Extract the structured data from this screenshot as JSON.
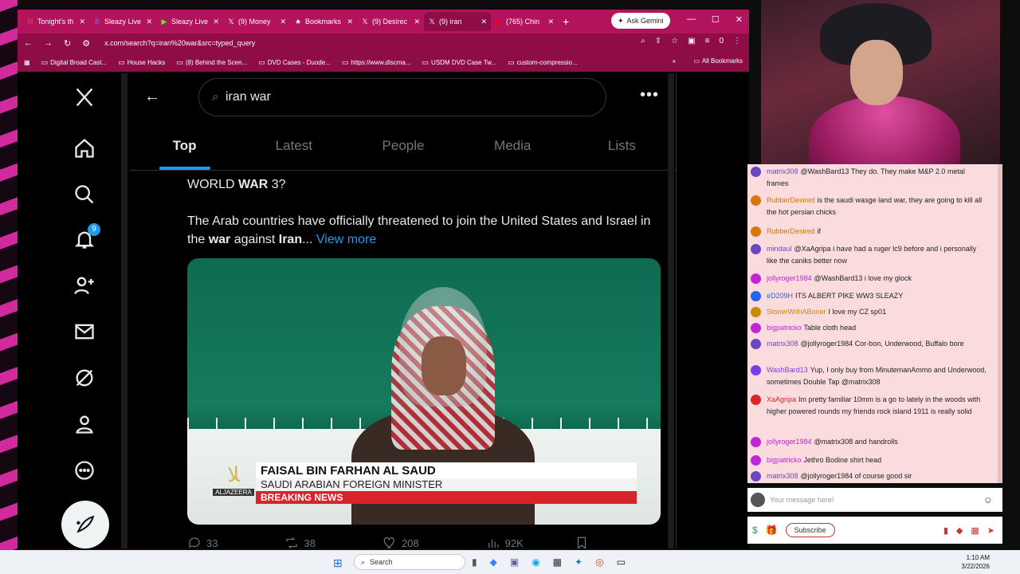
{
  "browser": {
    "tabs": [
      {
        "icon": "gmail-icon",
        "glyph": "M",
        "color": "#ea4335",
        "label": "Tonight's th"
      },
      {
        "icon": "kick-icon",
        "glyph": "B",
        "color": "#4f7cff",
        "label": "Sleazy Live"
      },
      {
        "icon": "kick-icon",
        "glyph": "▶",
        "color": "#53fc18",
        "label": "Sleazy Live"
      },
      {
        "icon": "x-logo-icon",
        "glyph": "𝕏",
        "color": "#ffffff",
        "label": "(9) Money"
      },
      {
        "icon": "bookmark-star-icon",
        "glyph": "★",
        "color": "#ffffff",
        "label": "Bookmarks"
      },
      {
        "icon": "x-logo-icon",
        "glyph": "𝕏",
        "color": "#ffffff",
        "label": "(9) Desirec"
      },
      {
        "icon": "x-logo-icon",
        "glyph": "𝕏",
        "color": "#ffffff",
        "label": "(9) iran"
      },
      {
        "icon": "youtube-icon",
        "glyph": "▶",
        "color": "#ff0000",
        "label": "(765) Chin"
      }
    ],
    "ask_gemini": "Ask Gemini",
    "url": "x.com/search?q=iran%20war&src=typed_query",
    "profile_initial": "0",
    "bookmarks": [
      {
        "icon": "folder-icon",
        "label": "Digital Broad Cast..."
      },
      {
        "icon": "folder-icon",
        "label": "House Hacks"
      },
      {
        "icon": "youtube-icon",
        "label": "(8) Behind the Scen..."
      },
      {
        "icon": "dvd-icon",
        "label": "DVD Cases - Duode..."
      },
      {
        "icon": "globe-icon",
        "label": "https://www.discma..."
      },
      {
        "icon": "globe-icon",
        "label": "USDM DVD Case Tw..."
      },
      {
        "icon": "globe-icon",
        "label": "custom-compressio..."
      }
    ],
    "all_bookmarks": "All Bookmarks"
  },
  "x": {
    "notification_count": "9",
    "search_query": "iran war",
    "tabs": [
      "Top",
      "Latest",
      "People",
      "Media",
      "Lists"
    ],
    "tweet": {
      "line1_pre": "WORLD ",
      "line1_bold": "WAR",
      "line1_post": " 3?",
      "p2_a": "The Arab countries have officially threatened to join the United States and Israel in the ",
      "p2_b": "war",
      "p2_c": " against ",
      "p2_d": "Iran",
      "p2_e": "... ",
      "view_more": "View more",
      "lower_third_name": "FAISAL BIN FARHAN AL SAUD",
      "lower_third_title": "SAUDI ARABIAN FOREIGN MINISTER",
      "lower_third_breaking": "BREAKING NEWS",
      "network": "ALJAZEERA",
      "replies": "33",
      "reposts": "38",
      "likes": "208",
      "views": "92K"
    }
  },
  "chat": {
    "messages": [
      {
        "user": "matrix308",
        "color": "#6b46c1",
        "text": "@WashBard13 They do. They make M&P 2.0 metal frames"
      },
      {
        "user": "RubberDesired",
        "color": "#d97706",
        "text": "is the saudi wasge land war, they are going to kill all the hot persian chicks"
      },
      {
        "user": "RubberDesired",
        "color": "#d97706",
        "text": "if"
      },
      {
        "user": "mindaul",
        "color": "#6b46c1",
        "text": "@XaAgripa i have had a ruger lc9 before and i personally like the caniks better now"
      },
      {
        "user": "jollyroger1984",
        "color": "#c026d3",
        "text": "@WashBard13 i love my glock"
      },
      {
        "user": "eD209H",
        "color": "#2563eb",
        "text": "ITS ALBERT PIKE WW3 SLEAZY"
      },
      {
        "user": "StonerWithABoner",
        "color": "#ca8a04",
        "text": "I love my CZ sp01"
      },
      {
        "user": "bigpatricko",
        "color": "#c026d3",
        "text": "Table cloth head"
      },
      {
        "user": "matrix308",
        "color": "#6b46c1",
        "text": "@jollyroger1984 Cor-bon, Underwood, Buffalo bore"
      },
      {
        "user": "WashBard13",
        "color": "#7c3aed",
        "text": "Yup, I only buy from MinutemanAmmo and Underwood, sometimes Double Tap @matrix308"
      },
      {
        "user": "XaAgripa",
        "color": "#dc2626",
        "text": "Im pretty familiar 10mm is a go to lately in the woods with higher powered rounds my friends rock island 1911 is really solid"
      },
      {
        "user": "jollyroger1984",
        "color": "#c026d3",
        "text": "@matrix308 and handrolls"
      },
      {
        "user": "bigpatricko",
        "color": "#c026d3",
        "text": "Jethro Bodine shirt head"
      },
      {
        "user": "matrix308",
        "color": "#6b46c1",
        "text": "@jollyroger1984 of course good sir"
      }
    ],
    "input_placeholder": "Your message here!",
    "subscribe": "Subscribe"
  },
  "taskbar": {
    "search": "Search",
    "time": "1:10 AM",
    "date": "3/22/2026"
  }
}
